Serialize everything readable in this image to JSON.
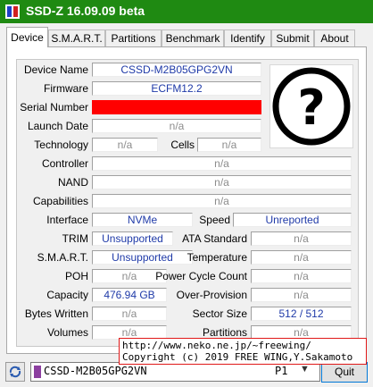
{
  "window": {
    "title": "SSD-Z 16.09.09 beta"
  },
  "tabs": [
    {
      "label": "Device",
      "active": true
    },
    {
      "label": "S.M.A.R.T."
    },
    {
      "label": "Partitions"
    },
    {
      "label": "Benchmark"
    },
    {
      "label": "Identify"
    },
    {
      "label": "Submit"
    },
    {
      "label": "About"
    }
  ],
  "device": {
    "device_name": {
      "label": "Device Name",
      "value": "CSSD-M2B05GPG2VN"
    },
    "firmware": {
      "label": "Firmware",
      "value": "ECFM12.2"
    },
    "serial_number": {
      "label": "Serial Number",
      "value": "",
      "redacted_color": "#ff0000"
    },
    "launch_date": {
      "label": "Launch Date",
      "value": "n/a"
    },
    "technology": {
      "label": "Technology",
      "value": "n/a"
    },
    "cells": {
      "label": "Cells",
      "value": "n/a"
    },
    "controller": {
      "label": "Controller",
      "value": "n/a"
    },
    "nand": {
      "label": "NAND",
      "value": "n/a"
    },
    "capabilities": {
      "label": "Capabilities",
      "value": "n/a"
    },
    "interface": {
      "label": "Interface",
      "value": "NVMe"
    },
    "speed": {
      "label": "Speed",
      "value": "Unreported"
    },
    "trim": {
      "label": "TRIM",
      "value": "Unsupported"
    },
    "ata_standard": {
      "label": "ATA Standard",
      "value": "n/a"
    },
    "smart": {
      "label": "S.M.A.R.T.",
      "value": "Unsupported"
    },
    "temperature": {
      "label": "Temperature",
      "value": "n/a"
    },
    "poh": {
      "label": "POH",
      "value": "n/a"
    },
    "power_cycle_count": {
      "label": "Power Cycle Count",
      "value": "n/a"
    },
    "capacity": {
      "label": "Capacity",
      "value": "476.94 GB"
    },
    "over_provision": {
      "label": "Over-Provision",
      "value": "n/a"
    },
    "bytes_written": {
      "label": "Bytes Written",
      "value": "n/a"
    },
    "sector_size": {
      "label": "Sector Size",
      "value": "512 / 512"
    },
    "volumes": {
      "label": "Volumes",
      "value": "n/a"
    },
    "partitions": {
      "label": "Partitions",
      "value": "n/a"
    }
  },
  "credit": {
    "line1": "http://www.neko.ne.jp/~freewing/",
    "line2": "Copyright (c) 2019 FREE WING,Y.Sakamoto"
  },
  "bottom": {
    "drive": "CSSD-M2B05GPG2VN",
    "port": "P1",
    "quit_label": "Quit"
  },
  "icons": {
    "app": "ssd-z-app-icon",
    "unknown_drive": "question-mark-icon",
    "refresh": "refresh-icon",
    "dropdown": "chevron-down-icon"
  },
  "colors": {
    "titlebar": "#1f8a12",
    "value_text": "#1f3aa8",
    "na_text": "#8c8c8c",
    "credit_border": "#e01818"
  }
}
